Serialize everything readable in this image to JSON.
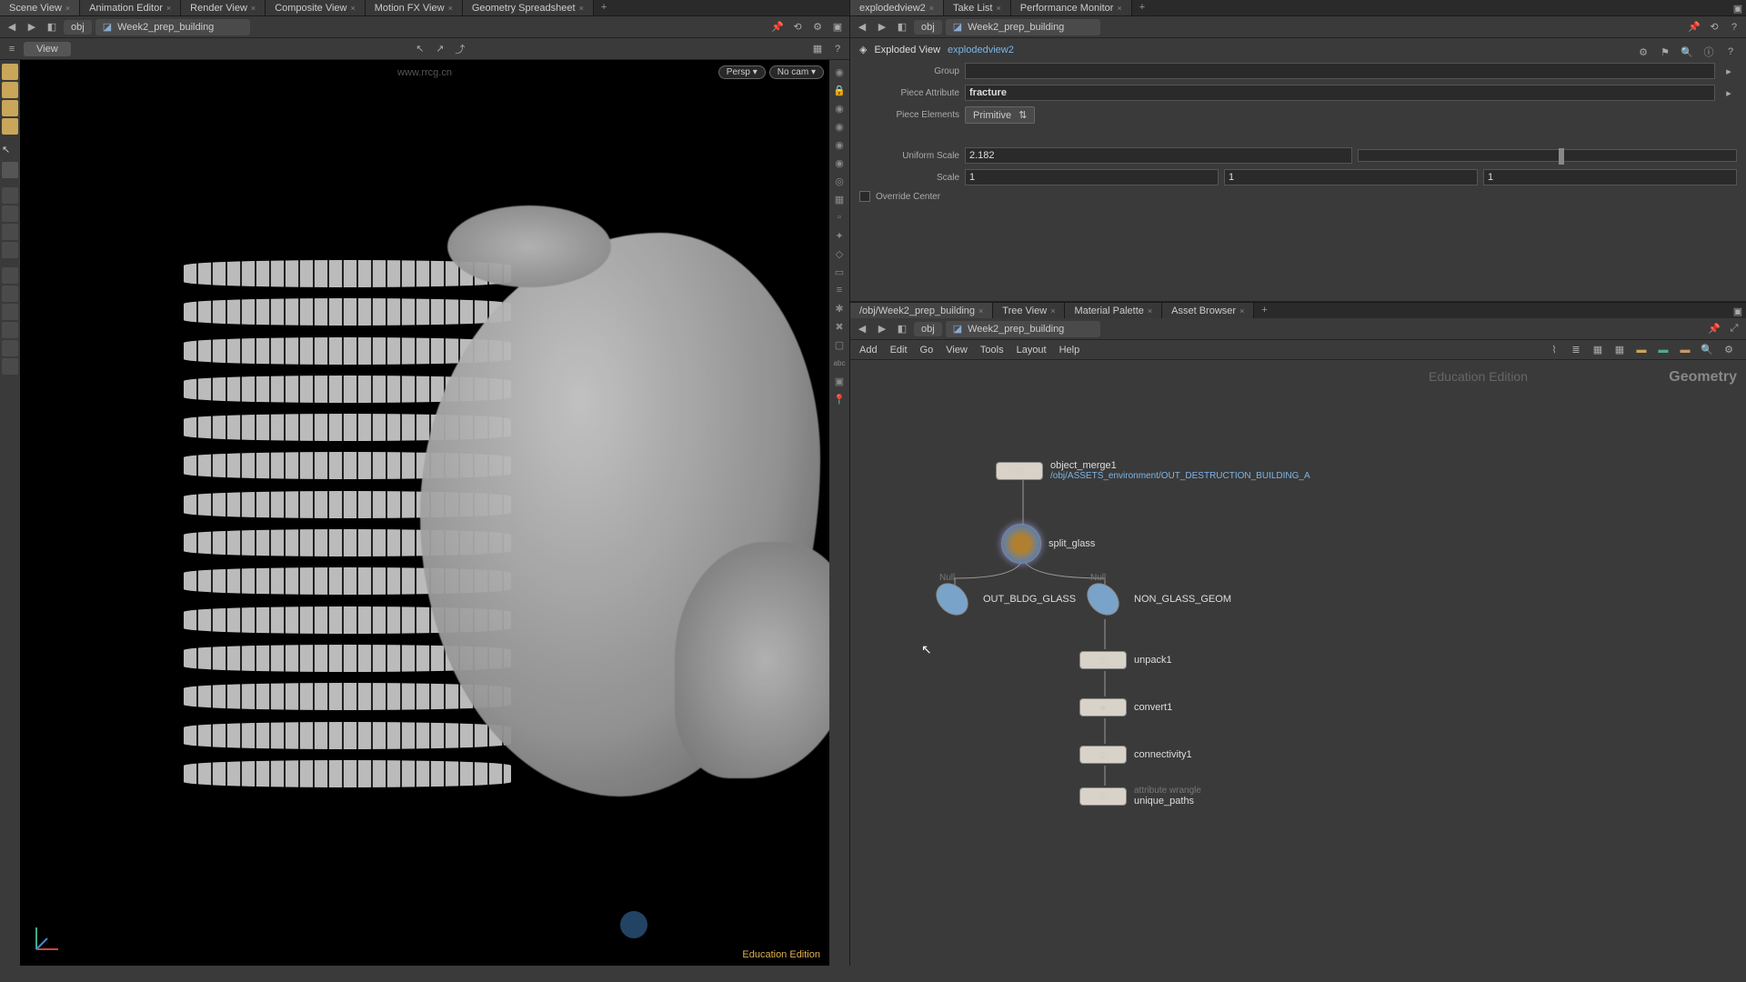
{
  "top_tabs_left": [
    "Scene View",
    "Animation Editor",
    "Render View",
    "Composite View",
    "Motion FX View",
    "Geometry Spreadsheet"
  ],
  "top_tabs_right": [
    "explodedview2",
    "Take List",
    "Performance Monitor"
  ],
  "path_left": {
    "context": "obj",
    "name": "Week2_prep_building"
  },
  "path_right": {
    "context": "obj",
    "name": "Week2_prep_building"
  },
  "watermark": "www.rrcg.cn",
  "view_label": "View",
  "persp_label": "Persp",
  "cam_label": "No cam",
  "edition": "Education Edition",
  "params": {
    "title": "Exploded View",
    "obj": "explodedview2",
    "group_label": "Group",
    "group_value": "",
    "piece_attr_label": "Piece Attribute",
    "piece_attr_value": "fracture",
    "piece_elem_label": "Piece Elements",
    "piece_elem_value": "Primitive",
    "uniform_scale_label": "Uniform Scale",
    "uniform_scale_value": "2.182",
    "scale_label": "Scale",
    "scale_x": "1",
    "scale_y": "1",
    "scale_z": "1",
    "override_label": "Override Center"
  },
  "net_tabs": [
    "/obj/Week2_prep_building",
    "Tree View",
    "Material Palette",
    "Asset Browser"
  ],
  "net_path": {
    "context": "obj",
    "name": "Week2_prep_building"
  },
  "net_menu": [
    "Add",
    "Edit",
    "Go",
    "View",
    "Tools",
    "Layout",
    "Help"
  ],
  "geom_label": "Geometry",
  "nodes": {
    "object_merge": {
      "label": "object_merge1",
      "sub": "/obj/ASSETS_environment/OUT_DESTRUCTION_BUILDING_A"
    },
    "split_glass": {
      "label": "split_glass"
    },
    "out_glass": {
      "type": "Null",
      "label": "OUT_BLDG_GLASS"
    },
    "non_glass": {
      "type": "Null",
      "label": "NON_GLASS_GEOM"
    },
    "unpack": {
      "label": "unpack1"
    },
    "convert": {
      "label": "convert1"
    },
    "connectivity": {
      "label": "connectivity1"
    },
    "attrwrangle": {
      "type_hint": "attribute wrangle",
      "label": "unique_paths"
    }
  }
}
